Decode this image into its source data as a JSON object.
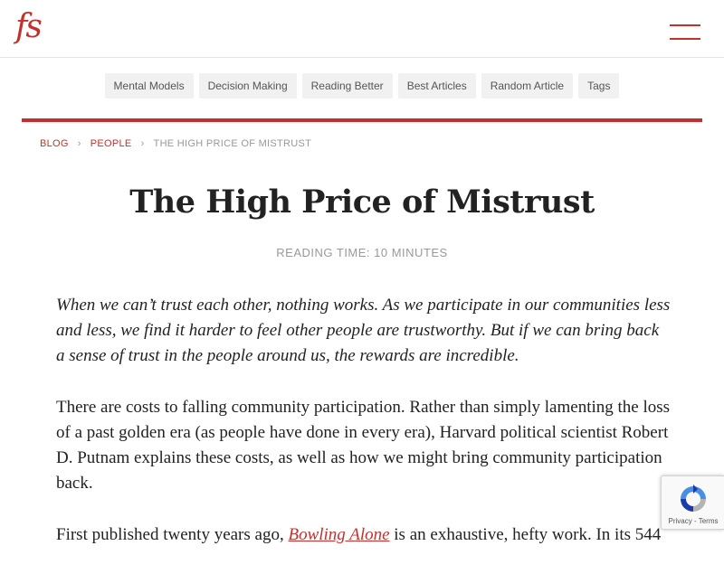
{
  "header": {
    "logo_text": "fs",
    "menu_icon": "hamburger-menu-icon"
  },
  "nav": {
    "items": [
      {
        "label": "Mental Models"
      },
      {
        "label": "Decision Making"
      },
      {
        "label": "Reading Better"
      },
      {
        "label": "Best Articles"
      },
      {
        "label": "Random Article"
      },
      {
        "label": "Tags"
      }
    ]
  },
  "breadcrumb": {
    "blog": "BLOG",
    "people": "PEOPLE",
    "current": "THE HIGH PRICE OF MISTRUST",
    "separator": "›"
  },
  "article": {
    "title": "The High Price of Mistrust",
    "reading_time": "READING TIME: 10 MINUTES",
    "intro": "When we can’t trust each other, nothing works. As we participate in our communities less and less, we find it harder to feel other people are trustworthy. But if we can bring back a sense of trust in the people around us, the rewards are incredible.",
    "paragraph1": "There are costs to falling community participation. Rather than simply lamenting the loss of a past golden era (as people have done in every era), Harvard political scientist Robert D. Putnam explains these costs, as well as how we might bring community participation back.",
    "paragraph2_start": "First published twenty years ago, ",
    "paragraph2_link": "Bowling Alone",
    "paragraph2_end": " is an exhaustive, hefty work. In its 544"
  },
  "recaptcha": {
    "label": "Privacy - Terms",
    "icon": "recaptcha-icon"
  },
  "colors": {
    "accent": "#c4302b",
    "nav_bg": "#f1f1f1",
    "muted_text": "#999999",
    "body_text": "#222222"
  }
}
